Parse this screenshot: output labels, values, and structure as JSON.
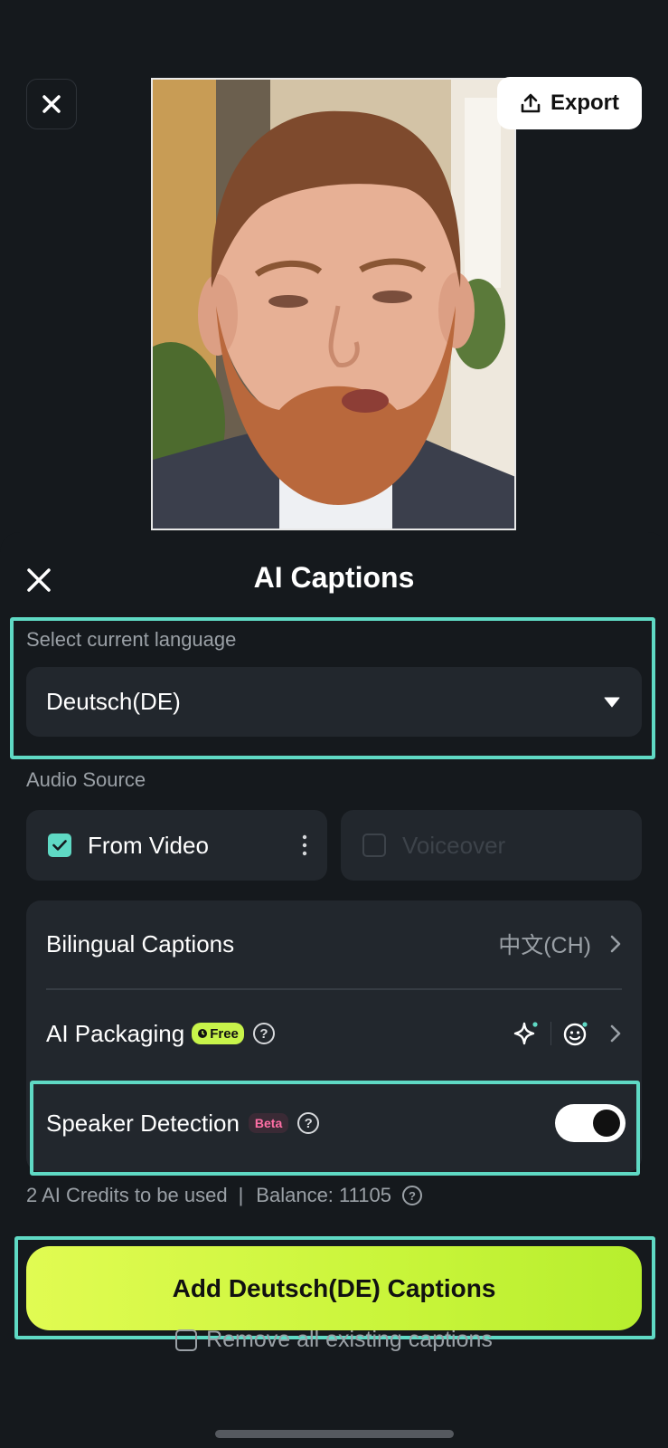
{
  "top": {
    "export_label": "Export"
  },
  "panel": {
    "title": "AI Captions",
    "language": {
      "label": "Select current language",
      "selected": "Deutsch(DE)"
    },
    "audio_source": {
      "label": "Audio Source",
      "from_video": {
        "label": "From Video",
        "checked": true
      },
      "voiceover": {
        "label": "Voiceover",
        "checked": false,
        "enabled": false
      }
    },
    "options": {
      "bilingual": {
        "label": "Bilingual Captions",
        "value": "中文(CH)"
      },
      "ai_packaging": {
        "label": "AI Packaging",
        "badge": "Free"
      },
      "speaker_detection": {
        "label": "Speaker Detection",
        "badge": "Beta",
        "enabled": true
      }
    },
    "credits": {
      "used": "2 AI Credits to be used",
      "separator": "|",
      "balance": "Balance: 11105"
    },
    "add_button_label": "Add Deutsch(DE) Captions",
    "remove_existing": {
      "label": "Remove all existing captions",
      "checked": false
    }
  },
  "colors": {
    "accent_lime": "#c9f53a",
    "highlight_teal": "#5fd9c4",
    "beta_pink": "#ff6fa5"
  }
}
